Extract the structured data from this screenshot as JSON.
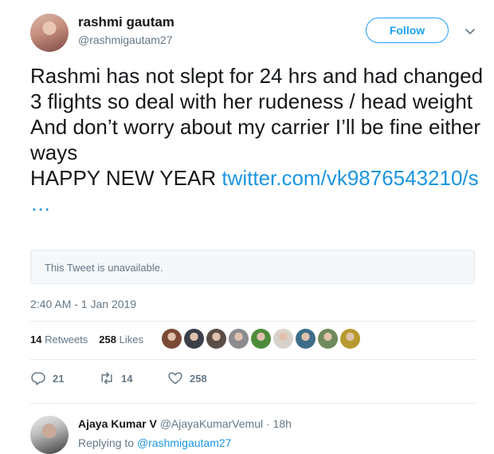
{
  "author": {
    "display_name": "rashmi gautam",
    "handle": "@rashmigautam27",
    "follow_label": "Follow"
  },
  "tweet": {
    "text": "Rashmi has not slept for 24 hrs and had changed 3 flights so deal with her rudeness / head weight\nAnd don’t worry about my carrier I’ll be fine either ways\nHAPPY NEW YEAR ",
    "link_text": "twitter.com/vk9876543210/s …",
    "quoted_unavailable": "This Tweet is unavailable.",
    "timestamp": "2:40 AM - 1 Jan 2019"
  },
  "stats": {
    "retweets_count": "14",
    "retweets_label": "Retweets",
    "likes_count": "258",
    "likes_label": "Likes"
  },
  "likers": [
    {
      "color": "#7a4a34"
    },
    {
      "color": "#3b3f48"
    },
    {
      "color": "#5a4e46"
    },
    {
      "color": "#8a8c8f"
    },
    {
      "color": "#4d8b3b"
    },
    {
      "color": "#d8d2cc"
    },
    {
      "color": "#3c6e8a"
    },
    {
      "color": "#6f8a5b"
    },
    {
      "color": "#b79a2e"
    }
  ],
  "actions": {
    "reply_count": "21",
    "retweet_count": "14",
    "like_count": "258",
    "reply_icon": "reply-icon",
    "retweet_icon": "retweet-icon",
    "like_icon": "heart-icon"
  },
  "reply": {
    "name": "Ajaya Kumar V",
    "handle_time": "@AjayaKumarVemul · 18h",
    "replying_to_label": "Replying to",
    "replying_to_handle": "@rashmigautam27"
  }
}
